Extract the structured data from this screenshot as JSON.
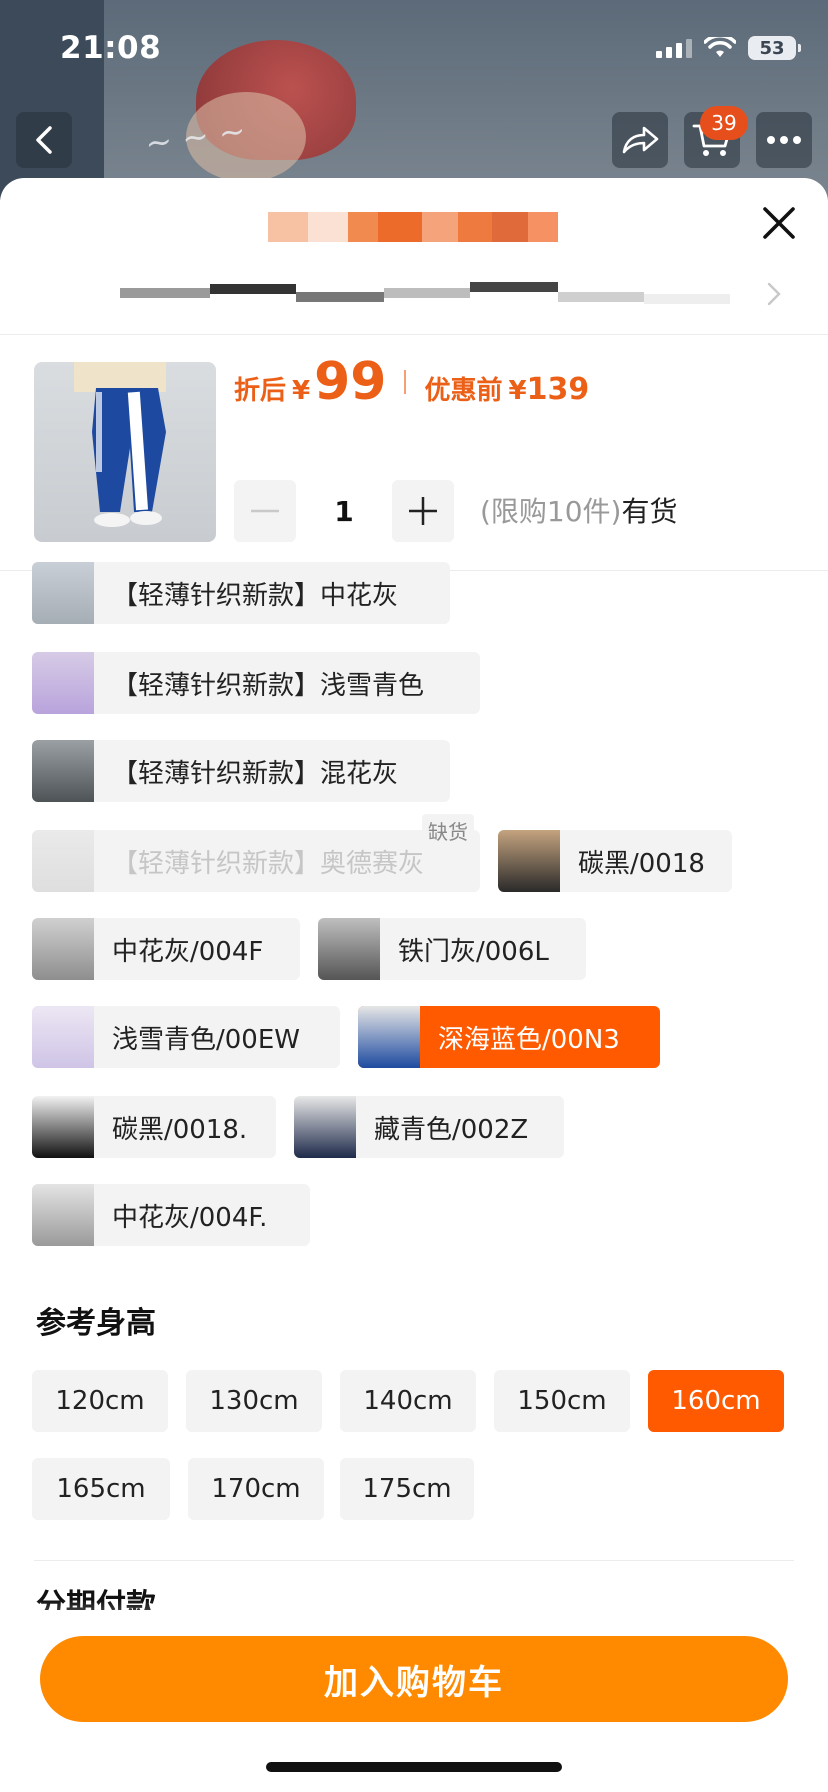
{
  "status_bar": {
    "time": "21:08",
    "battery": "53"
  },
  "header": {
    "cart_badge": "39"
  },
  "product": {
    "price_label": "折后",
    "price_currency": "¥",
    "price": "99",
    "original_label": "优惠前",
    "original_currency": "¥",
    "original_price": "139",
    "quantity": "1",
    "limit_text": "(限购10件)",
    "stock_text": "有货"
  },
  "variants": [
    {
      "label": "【轻薄针织新款】中花灰",
      "state": "normal"
    },
    {
      "label": "【轻薄针织新款】浅雪青色",
      "state": "normal"
    },
    {
      "label": "【轻薄针织新款】混花灰",
      "state": "normal"
    },
    {
      "label": "【轻薄针织新款】奥德赛灰",
      "state": "disabled"
    },
    {
      "label": "碳黑/0018",
      "state": "normal"
    },
    {
      "label": "中花灰/004F",
      "state": "normal"
    },
    {
      "label": "铁门灰/006L",
      "state": "normal"
    },
    {
      "label": "浅雪青色/00EW",
      "state": "normal"
    },
    {
      "label": "深海蓝色/00N3",
      "state": "selected"
    },
    {
      "label": "碳黑/0018.",
      "state": "normal"
    },
    {
      "label": "藏青色/002Z",
      "state": "normal"
    },
    {
      "label": "中花灰/004F.",
      "state": "normal"
    }
  ],
  "out_of_stock_tag": "缺货",
  "size_section": {
    "title": "参考身高",
    "sizes": [
      {
        "label": "120cm",
        "selected": false
      },
      {
        "label": "130cm",
        "selected": false
      },
      {
        "label": "140cm",
        "selected": false
      },
      {
        "label": "150cm",
        "selected": false
      },
      {
        "label": "160cm",
        "selected": true
      },
      {
        "label": "165cm",
        "selected": false
      },
      {
        "label": "170cm",
        "selected": false
      },
      {
        "label": "175cm",
        "selected": false
      }
    ]
  },
  "installment_title": "分期付款",
  "cta": {
    "label": "加入购物车"
  },
  "colors": {
    "accent": "#ff5a00",
    "price": "#ec5f17",
    "cta": "#ff8a00"
  }
}
